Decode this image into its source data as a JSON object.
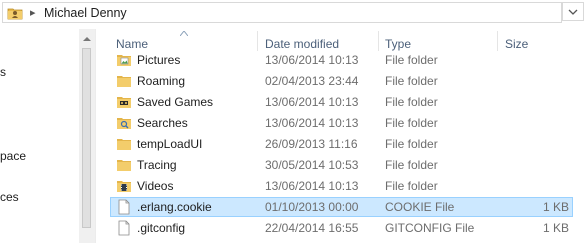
{
  "address": {
    "separator": "▸",
    "path": "Michael Denny",
    "folder_icon": "user-folder-icon",
    "dropdown_icon": "chevron-down-icon"
  },
  "nav": {
    "items": [
      {
        "label": "s"
      },
      {
        "label": "pace"
      },
      {
        "label": "ces"
      }
    ]
  },
  "columns": {
    "name": "Name",
    "date": "Date modified",
    "type": "Type",
    "size": "Size"
  },
  "files": [
    {
      "name": "Pictures",
      "date": "13/06/2014 10:13",
      "type": "File folder",
      "size": "",
      "icon": "pictures-folder-icon"
    },
    {
      "name": "Roaming",
      "date": "02/04/2013 23:44",
      "type": "File folder",
      "size": "",
      "icon": "folder-icon"
    },
    {
      "name": "Saved Games",
      "date": "13/06/2014 10:13",
      "type": "File folder",
      "size": "",
      "icon": "saved-games-folder-icon"
    },
    {
      "name": "Searches",
      "date": "13/06/2014 10:13",
      "type": "File folder",
      "size": "",
      "icon": "searches-folder-icon"
    },
    {
      "name": "tempLoadUI",
      "date": "26/09/2013 11:16",
      "type": "File folder",
      "size": "",
      "icon": "folder-icon"
    },
    {
      "name": "Tracing",
      "date": "30/05/2014 10:53",
      "type": "File folder",
      "size": "",
      "icon": "folder-icon"
    },
    {
      "name": "Videos",
      "date": "13/06/2014 10:13",
      "type": "File folder",
      "size": "",
      "icon": "videos-folder-icon"
    },
    {
      "name": ".erlang.cookie",
      "date": "01/10/2013 00:00",
      "type": "COOKIE File",
      "size": "1 KB",
      "icon": "file-icon",
      "selected": true
    },
    {
      "name": ".gitconfig",
      "date": "22/04/2014 16:55",
      "type": "GITCONFIG File",
      "size": "1 KB",
      "icon": "file-icon"
    }
  ],
  "colors": {
    "selection_bg": "#cce8ff",
    "selection_border": "#99d1ff",
    "header_text": "#4c607a",
    "folder_yellow": "#f0c25a"
  }
}
